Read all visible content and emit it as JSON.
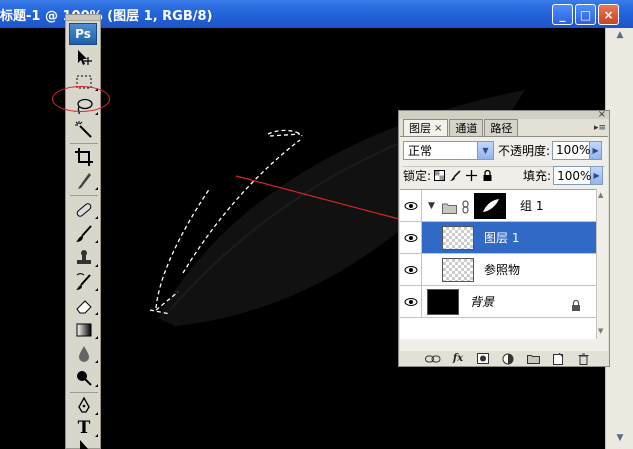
{
  "window": {
    "title": "标题-1 @ 100% (图层 1, RGB/8)",
    "buttons": {
      "minimize": "_",
      "maximize": "□",
      "close": "×"
    }
  },
  "toolbox": {
    "logo": "Ps",
    "tools": [
      {
        "name": "move-tool",
        "icon": "move-icon"
      },
      {
        "name": "marquee-tool",
        "icon": "marquee-icon"
      },
      {
        "name": "lasso-tool",
        "icon": "lasso-icon",
        "highlighted": true
      },
      {
        "name": "magic-wand-tool",
        "icon": "magic-wand-icon"
      },
      {
        "name": "crop-tool",
        "icon": "crop-icon"
      },
      {
        "name": "slice-tool",
        "icon": "slice-icon"
      },
      {
        "name": "healing-brush-tool",
        "icon": "bandage-icon"
      },
      {
        "name": "brush-tool",
        "icon": "brush-icon"
      },
      {
        "name": "clone-stamp-tool",
        "icon": "stamp-icon"
      },
      {
        "name": "history-brush-tool",
        "icon": "history-brush-icon"
      },
      {
        "name": "eraser-tool",
        "icon": "eraser-icon"
      },
      {
        "name": "gradient-tool",
        "icon": "gradient-icon"
      },
      {
        "name": "blur-tool",
        "icon": "blur-drop-icon"
      },
      {
        "name": "dodge-tool",
        "icon": "dodge-icon"
      },
      {
        "name": "pen-tool",
        "icon": "pen-icon"
      },
      {
        "name": "type-tool",
        "icon": "type-icon",
        "label": "T"
      },
      {
        "name": "path-selection-tool",
        "icon": "arrow-select-icon"
      },
      {
        "name": "shape-tool",
        "icon": "rectangle-icon"
      }
    ]
  },
  "layers_panel": {
    "tabs": [
      {
        "label": "图层",
        "active": true,
        "close": "×"
      },
      {
        "label": "通道",
        "active": false
      },
      {
        "label": "路径",
        "active": false
      }
    ],
    "close": "×",
    "menu": "▸≡",
    "blend_mode": "正常",
    "opacity_label": "不透明度:",
    "opacity_value": "100%",
    "lock_label": "锁定:",
    "fill_label": "填充:",
    "fill_value": "100%",
    "layers": [
      {
        "name": "组 1",
        "type": "group",
        "visible": true,
        "selected": false
      },
      {
        "name": "图层 1",
        "type": "layer",
        "visible": true,
        "selected": true
      },
      {
        "name": "参照物",
        "type": "layer",
        "visible": true,
        "selected": false
      },
      {
        "name": "背景",
        "type": "background",
        "visible": true,
        "selected": false,
        "locked": true
      }
    ]
  },
  "colors": {
    "titlebar": "#2466dc",
    "selected_layer": "#3169c6",
    "annotation": "#d8262a",
    "canvas": "#000000"
  }
}
